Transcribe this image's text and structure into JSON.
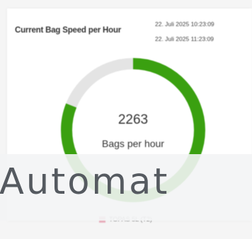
{
  "widget": {
    "title": "Current Bag Speed per Hour",
    "time_from": "22. Juli 2025 10:23:09",
    "time_to": "22. Juli 2025 11:23:09"
  },
  "gauge": {
    "value": "2263",
    "unit": "Bags per hour",
    "fill_fraction": 0.81,
    "color_fill": "#3aa010",
    "color_track": "#e4e4e4"
  },
  "legend": {
    "label": "TOPAS 5L (T2)",
    "color": "#e8b4c0"
  },
  "overlay": {
    "text": "Automat"
  }
}
